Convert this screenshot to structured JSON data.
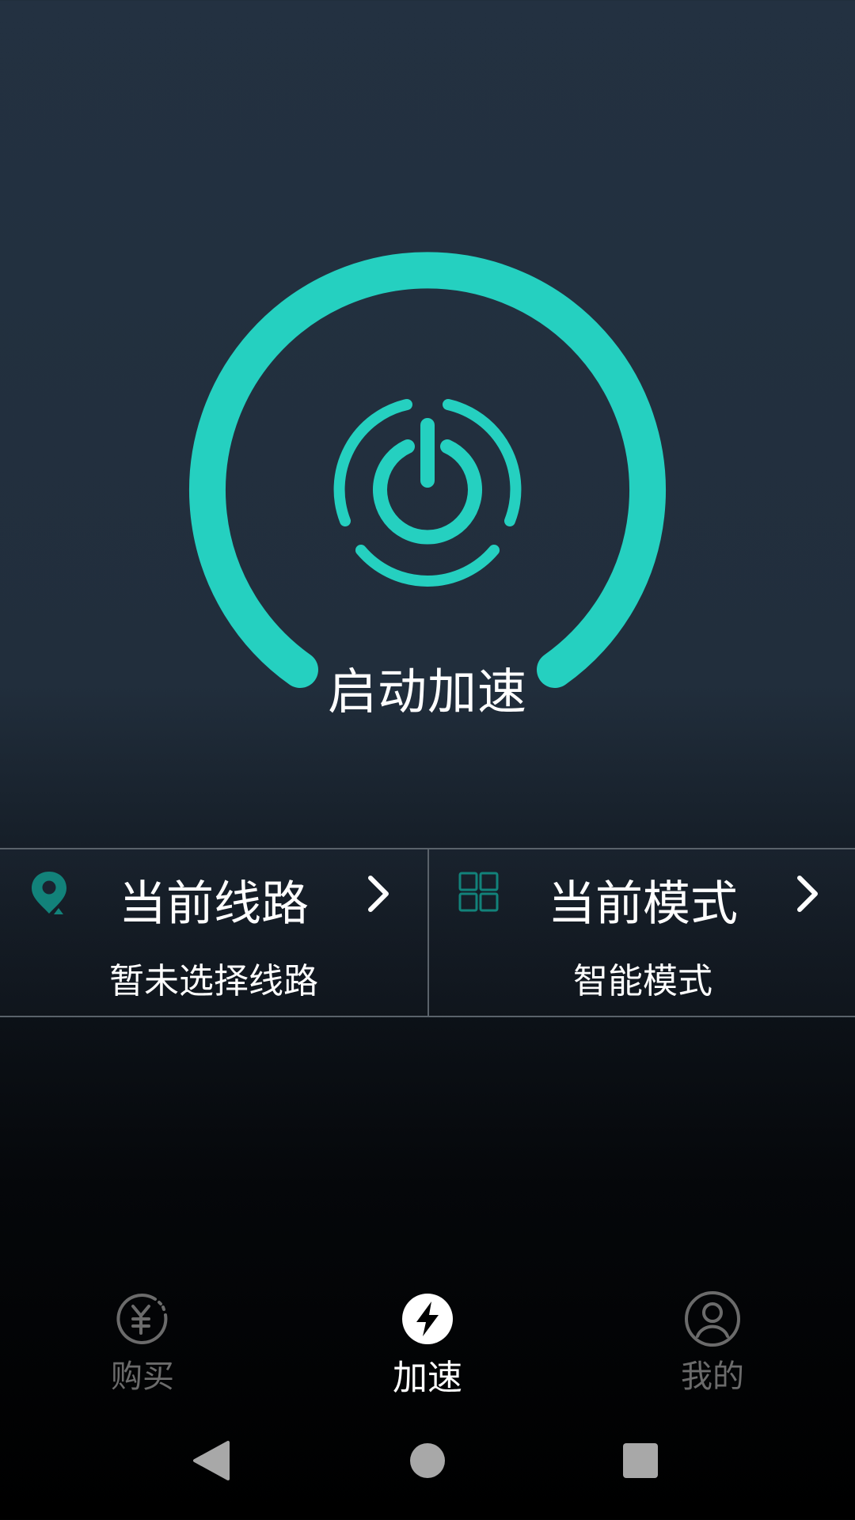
{
  "theme": {
    "accent": "#25d0c0",
    "accent_dark": "#12827a",
    "divider": "#5a626a",
    "inactive": "#6b6b6b"
  },
  "power": {
    "label": "启动加速",
    "icon": "power-icon"
  },
  "route": {
    "icon": "location-pin-icon",
    "title": "当前线路",
    "value": "暂未选择线路"
  },
  "mode": {
    "icon": "grid-icon",
    "title": "当前模式",
    "value": "智能模式"
  },
  "tabs": [
    {
      "label": "购买",
      "icon": "yuan-coin-icon",
      "active": false
    },
    {
      "label": "加速",
      "icon": "lightning-bolt-icon",
      "active": true
    },
    {
      "label": "我的",
      "icon": "user-profile-icon",
      "active": false
    }
  ],
  "system_nav": {
    "back_icon": "back-triangle-icon",
    "home_icon": "home-circle-icon",
    "recents_icon": "recents-square-icon"
  }
}
